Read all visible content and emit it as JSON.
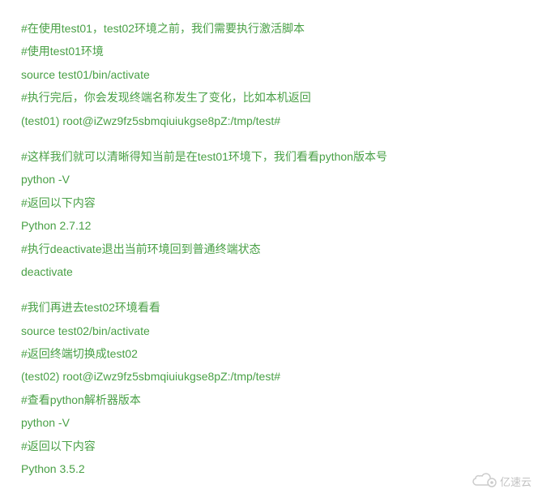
{
  "lines": [
    "#在使用test01，test02环境之前，我们需要执行激活脚本",
    "#使用test01环境",
    "source test01/bin/activate",
    "#执行完后，你会发现终端名称发生了变化，比如本机返回",
    "(test01) root@iZwz9fz5sbmqiuiukgse8pZ:/tmp/test#",
    "",
    "#这样我们就可以清晰得知当前是在test01环境下，我们看看python版本号",
    "python -V",
    "#返回以下内容",
    "Python 2.7.12",
    "#执行deactivate退出当前环境回到普通终端状态",
    "deactivate",
    "",
    "#我们再进去test02环境看看",
    "source test02/bin/activate",
    "#返回终端切换成test02",
    "(test02) root@iZwz9fz5sbmqiuiukgse8pZ:/tmp/test#",
    "#查看python解析器版本",
    "python -V",
    "#返回以下内容",
    "Python 3.5.2"
  ],
  "watermark": {
    "text": "亿速云"
  }
}
